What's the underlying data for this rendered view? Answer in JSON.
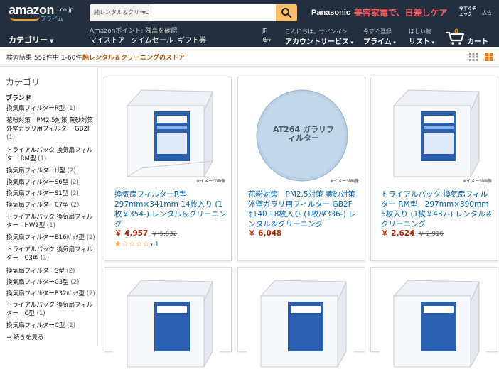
{
  "header": {
    "logo": {
      "main": "amazon",
      "suffix": ".co.jp",
      "sub": "プライム"
    },
    "search": {
      "scope": "純レンタル＆クリーニング",
      "value": "",
      "placeholder": ""
    },
    "promo": {
      "brand": "Panasonic",
      "text": "美容家電で、日差しケア",
      "check": "今すぐチェック",
      "ad": "広告"
    },
    "category_menu": "カテゴリー",
    "swm": "Amazonポイント: 残高を確認",
    "nav_links": [
      "マイストア",
      "タイムセール",
      "ギフト券"
    ],
    "lang_code": "JP",
    "account": {
      "greeting": "こんにちは。サインイン",
      "label": "アカウントサービス"
    },
    "prime": {
      "small": "今すぐ登録",
      "label": "プライム"
    },
    "wishlist": {
      "small": "ほしい物",
      "label": "リスト"
    },
    "cart": {
      "count": "0",
      "label": "カート"
    }
  },
  "results": {
    "count_text": "検索結果 552件中 1-60件",
    "store_text": "純レンタル＆クリーニングのストア"
  },
  "sidebar": {
    "title": "カテゴリ",
    "brand_heading": "ブランド",
    "items": [
      {
        "label": "換気扇フィルターR型",
        "count": "(1)"
      },
      {
        "label": "花粉対策　PM2.5対策 黄砂対策 外壁ガラリ用フィルター GB2F",
        "count": "(1)"
      },
      {
        "label": "トライアルパック 換気扇フィルター RM型",
        "count": "(1)"
      },
      {
        "label": "換気扇フィルターH型",
        "count": "(2)"
      },
      {
        "label": "換気扇フィルターS6型",
        "count": "(2)"
      },
      {
        "label": "換気扇フィルターS1型",
        "count": "(2)"
      },
      {
        "label": "換気扇フィルターC7型",
        "count": "(2)"
      },
      {
        "label": "トライアルパック 換気扇フィルター　HW2型",
        "count": "(1)"
      },
      {
        "label": "換気扇フィルターB16ﾊﾟｯｸ型",
        "count": "(2)"
      },
      {
        "label": "トライアルパック 換気扇フィルター　C3型",
        "count": "(1)"
      },
      {
        "label": "換気扇フィルターS型",
        "count": "(2)"
      },
      {
        "label": "換気扇フィルターC3型",
        "count": "(2)"
      },
      {
        "label": "換気扇フィルターB32ﾊﾟｯｸ型",
        "count": "(2)"
      },
      {
        "label": "トライアルパック 換気扇フィルター　C型",
        "count": "(1)"
      },
      {
        "label": "換気扇フィルターC型",
        "count": "(2)"
      }
    ],
    "see_more": "+ 続きを見る"
  },
  "products": [
    {
      "title": "換気扇フィルターR型 297mm×341mm 14枚入り (1枚￥354-) レンタル＆クリーニング",
      "price": "￥ 4,957",
      "list_price": "￥ 5,832",
      "image_note": "※イメージ画像",
      "image_label": "",
      "rating": 1,
      "reviews": "1"
    },
    {
      "title": "花粉対策　PM2.5対策 黄砂対策 外壁ガラリ用フィルター GB2F ¢140 18枚入り (1枚/¥336-) レンタル＆クリーニング",
      "price": "￥ 6,048",
      "list_price": "",
      "image_note": "※イメージ画像",
      "image_label": "AT264 ガラリフィルター",
      "rating": null,
      "reviews": ""
    },
    {
      "title": "トライアルパック 換気扇フィルター RM型　297mm×390mm 6枚入り (1枚￥437-) レンタル＆クリーニング",
      "price": "￥ 2,624",
      "list_price": "￥ 2,916",
      "image_note": "※イメージ画像",
      "image_label": "",
      "rating": null,
      "reviews": ""
    }
  ],
  "colors": {
    "header_bg": "#232f3e",
    "accent_orange": "#febd69",
    "price_red": "#b12704",
    "link_blue": "#0066c0",
    "promo_pink": "#ff5a5f"
  }
}
